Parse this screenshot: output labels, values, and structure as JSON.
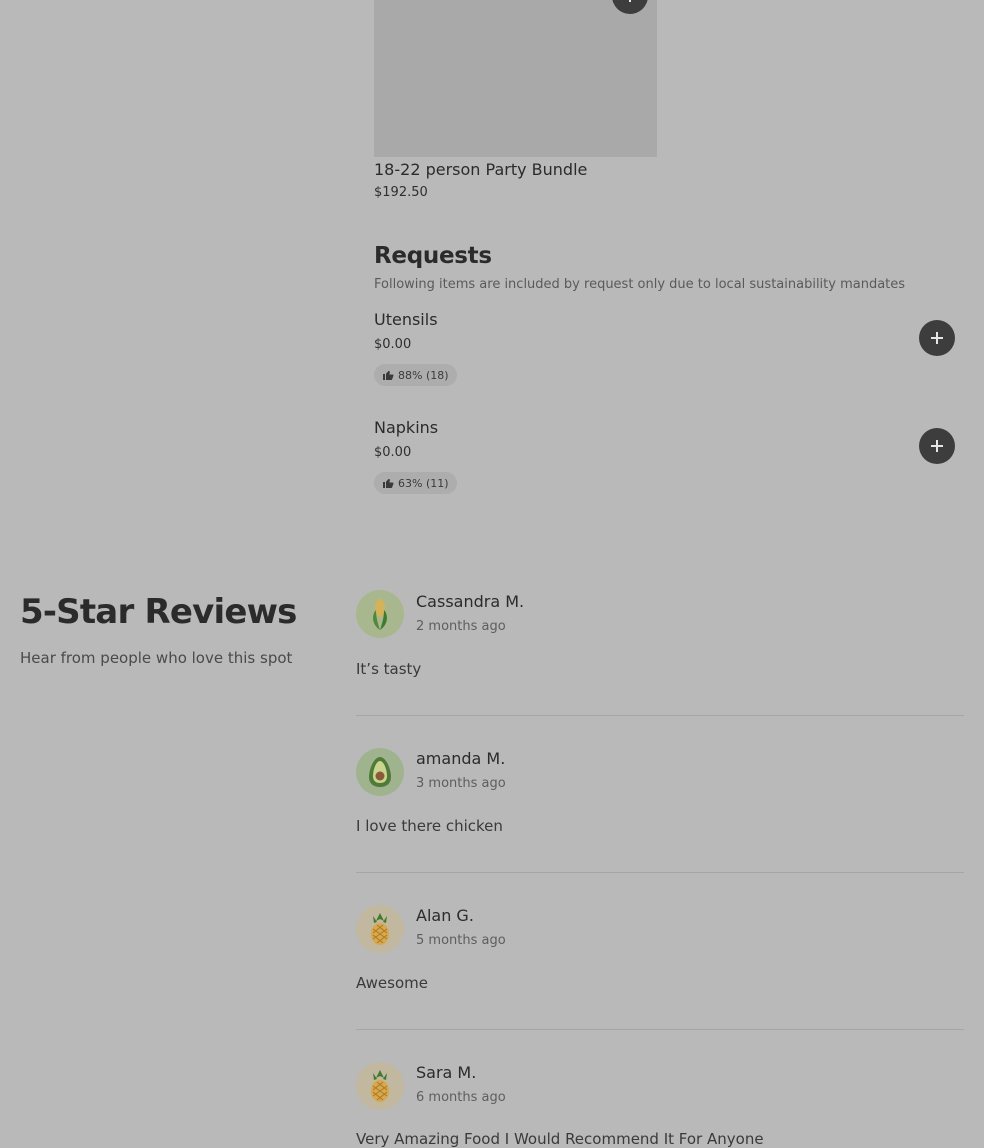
{
  "bundle": {
    "name": "18-22 person Party Bundle",
    "price": "$192.50"
  },
  "requests": {
    "title": "Requests",
    "subtitle": "Following items are included by request only due to local sustainability mandates",
    "items": [
      {
        "name": "Utensils",
        "price": "$0.00",
        "rating": "88% (18)"
      },
      {
        "name": "Napkins",
        "price": "$0.00",
        "rating": "63% (11)"
      }
    ]
  },
  "reviews": {
    "title": "5-Star Reviews",
    "subtitle": "Hear from people who love this spot",
    "items": [
      {
        "name": "Cassandra M.",
        "time": "2 months ago",
        "text": "It’s tasty",
        "avatar_icon": "corn-icon",
        "avatar_color": "#a8b78e"
      },
      {
        "name": "amanda M.",
        "time": "3 months ago",
        "text": "I love there chicken",
        "avatar_icon": "avocado-icon",
        "avatar_color": "#9fb38f"
      },
      {
        "name": "Alan G.",
        "time": "5 months ago",
        "text": "Awesome",
        "avatar_icon": "pineapple-icon",
        "avatar_color": "#c2b79f"
      },
      {
        "name": "Sara M.",
        "time": "6 months ago",
        "text": "Very Amazing Food I Would Recommend It For Anyone",
        "avatar_icon": "pineapple-icon",
        "avatar_color": "#c2b79f"
      }
    ]
  }
}
